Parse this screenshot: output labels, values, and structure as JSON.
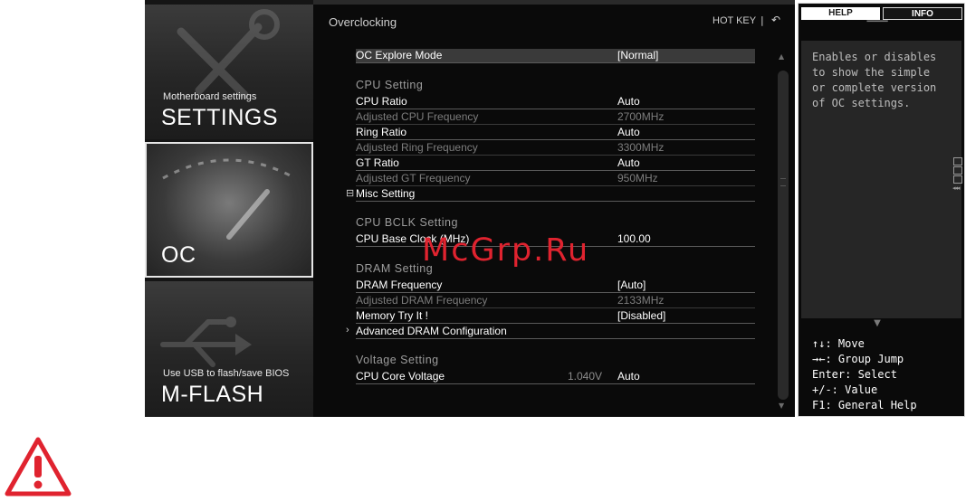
{
  "nav": {
    "settings": {
      "small": "Motherboard settings",
      "big": "SETTINGS"
    },
    "oc": {
      "big": "OC"
    },
    "mflash": {
      "small": "Use USB to flash/save BIOS",
      "big": "M-FLASH"
    }
  },
  "header": {
    "title": "Overclocking",
    "hotkey": "HOT KEY",
    "separator": "|",
    "back_glyph": "↶"
  },
  "rows": [
    {
      "label": "OC Explore Mode",
      "value": "[Normal]"
    },
    {
      "section": "CPU  Setting"
    },
    {
      "label": "CPU Ratio",
      "value": "Auto"
    },
    {
      "label": "Adjusted CPU Frequency",
      "value": "2700MHz"
    },
    {
      "label": "Ring Ratio",
      "value": "Auto"
    },
    {
      "label": "Adjusted Ring Frequency",
      "value": "3300MHz"
    },
    {
      "label": "GT Ratio",
      "value": "Auto"
    },
    {
      "label": "Adjusted GT Frequency",
      "value": " 950MHz"
    },
    {
      "label": "Misc Setting",
      "expander": "⊟"
    },
    {
      "section": "CPU  BCLK  Setting"
    },
    {
      "label": "CPU Base Clock (MHz)",
      "value": "100.00"
    },
    {
      "section": "DRAM  Setting"
    },
    {
      "label": "DRAM Frequency",
      "value": "[Auto]"
    },
    {
      "label": "Adjusted DRAM Frequency",
      "value": "2133MHz"
    },
    {
      "label": "Memory Try It !",
      "value": "[Disabled]"
    },
    {
      "label": "Advanced DRAM Configuration",
      "expander": "›"
    },
    {
      "section": "Voltage  Setting"
    },
    {
      "label": "CPU Core Voltage",
      "mid": "1.040V",
      "value": "Auto"
    }
  ],
  "help_panel": {
    "tabs": {
      "help": "HELP",
      "info": "INFO"
    },
    "text": "Enables or disables\nto show the simple\nor complete version\nof OC settings.",
    "keys": [
      "↑↓: Move",
      "→←: Group Jump",
      "Enter: Select",
      "+/-: Value",
      "F1: General Help"
    ]
  },
  "watermark": "McGrp.Ru",
  "colors": {
    "warning_red": "#e0232f",
    "panel_bg": "#0a0a0a",
    "highlight_row": "#3a3a3a"
  }
}
